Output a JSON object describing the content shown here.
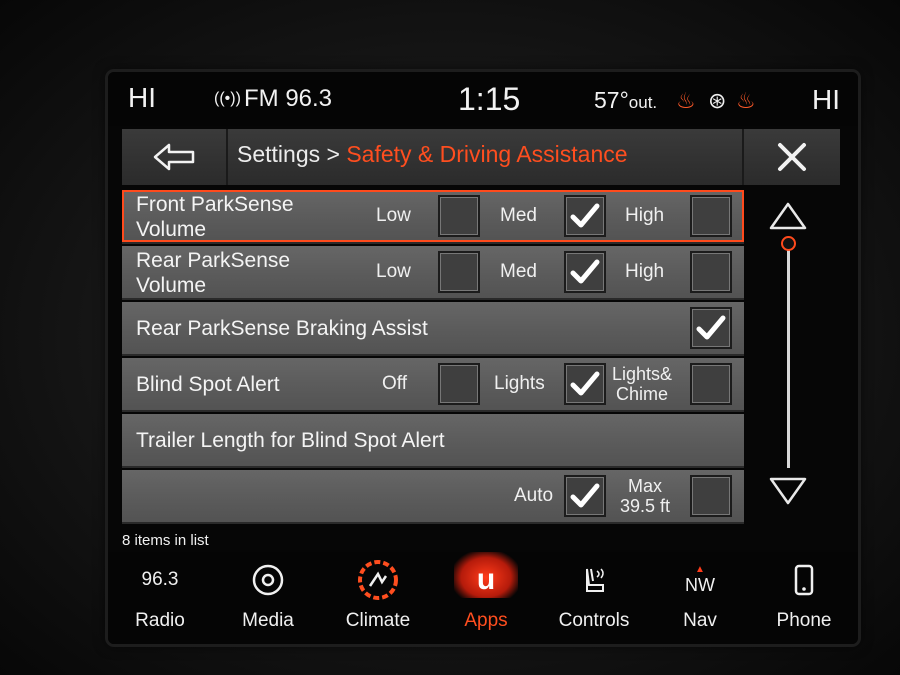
{
  "status": {
    "hi_left": "HI",
    "hi_right": "HI",
    "radio": "FM 96.3",
    "time": "1:15",
    "temp": "57°",
    "temp_suffix": "out."
  },
  "header": {
    "breadcrumb_parent": "Settings >",
    "breadcrumb_current": "Safety & Driving Assistance"
  },
  "rows": [
    {
      "label_l1": "Front ParkSense",
      "label_l2": "Volume",
      "opts": [
        {
          "label": "Low",
          "checked": false
        },
        {
          "label": "Med",
          "checked": true
        },
        {
          "label": "High",
          "checked": false
        }
      ]
    },
    {
      "label_l1": "Rear ParkSense",
      "label_l2": "Volume",
      "opts": [
        {
          "label": "Low",
          "checked": false
        },
        {
          "label": "Med",
          "checked": true
        },
        {
          "label": "High",
          "checked": false
        }
      ]
    },
    {
      "label": "Rear ParkSense Braking Assist",
      "checked": true
    },
    {
      "label": "Blind Spot Alert",
      "opts": [
        {
          "label": "Off",
          "checked": false
        },
        {
          "label": "Lights",
          "checked": true
        },
        {
          "label_l1": "Lights&",
          "label_l2": "Chime",
          "checked": false
        }
      ]
    },
    {
      "label": "Trailer Length for Blind Spot Alert"
    },
    {
      "opts": [
        {
          "label": "Auto",
          "checked": true
        },
        {
          "label_l1": "Max",
          "label_l2": "39.5 ft",
          "checked": false
        }
      ]
    }
  ],
  "footer": {
    "count": "8 items in list"
  },
  "nav": [
    {
      "label": "Radio",
      "icon_text": "96.3"
    },
    {
      "label": "Media"
    },
    {
      "label": "Climate"
    },
    {
      "label": "Apps",
      "icon_text": "u"
    },
    {
      "label": "Controls"
    },
    {
      "label": "Nav",
      "icon_text": "NW"
    },
    {
      "label": "Phone"
    }
  ],
  "colors": {
    "accent": "#ff4e1f",
    "row_bg": "#5e5e5e",
    "title_bg": "#333333"
  }
}
